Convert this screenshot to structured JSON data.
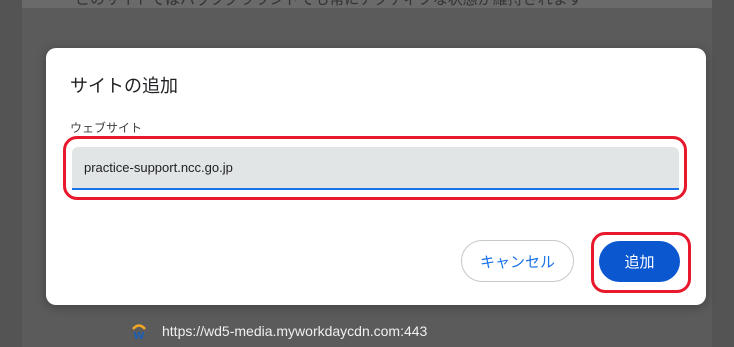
{
  "background": {
    "top_text": "このサイトではバックグラウンドでも常にアクティブな状態が維持されます",
    "site_row_url": "https://wd5-media.myworkdaycdn.com:443"
  },
  "dialog": {
    "title": "サイトの追加",
    "field_label": "ウェブサイト",
    "input_value": "practice-support.ncc.go.jp",
    "cancel_label": "キャンセル",
    "add_label": "追加"
  },
  "colors": {
    "accent": "#0b57d0",
    "highlight": "#e8192c",
    "input_underline": "#1a73e8"
  },
  "icons": {
    "site_icon": "workday-icon"
  }
}
